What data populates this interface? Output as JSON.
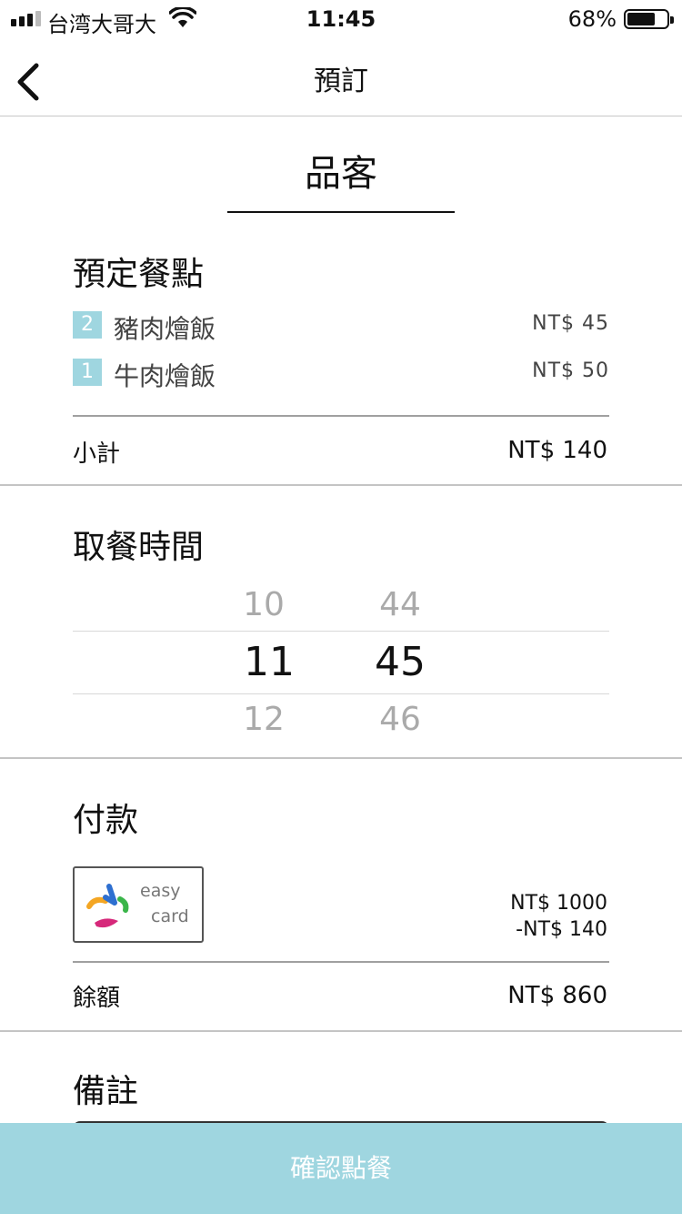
{
  "status_bar": {
    "carrier": "台湾大哥大",
    "time": "11:45",
    "battery": "68%"
  },
  "nav": {
    "title": "預訂"
  },
  "store": {
    "name": "品客"
  },
  "order": {
    "title": "預定餐點",
    "items": [
      {
        "qty": "2",
        "name": "豬肉燴飯",
        "price": "NT$ 45"
      },
      {
        "qty": "1",
        "name": "牛肉燴飯",
        "price": "NT$ 50"
      }
    ],
    "subtotal_label": "小計",
    "subtotal_value": "NT$ 140"
  },
  "pickup": {
    "title": "取餐時間",
    "hours": [
      "10",
      "11",
      "12"
    ],
    "minutes": [
      "44",
      "45",
      "46"
    ]
  },
  "payment": {
    "title": "付款",
    "card_text_1": "easy",
    "card_text_2": "card",
    "card_balance": "NT$ 1000",
    "charge": "-NT$ 140",
    "remaining_label": "餘額",
    "remaining_value": "NT$ 860"
  },
  "notes": {
    "title": "備註"
  },
  "confirm": {
    "label": "確認點餐"
  },
  "colors": {
    "accent": "#9fd6e0"
  }
}
